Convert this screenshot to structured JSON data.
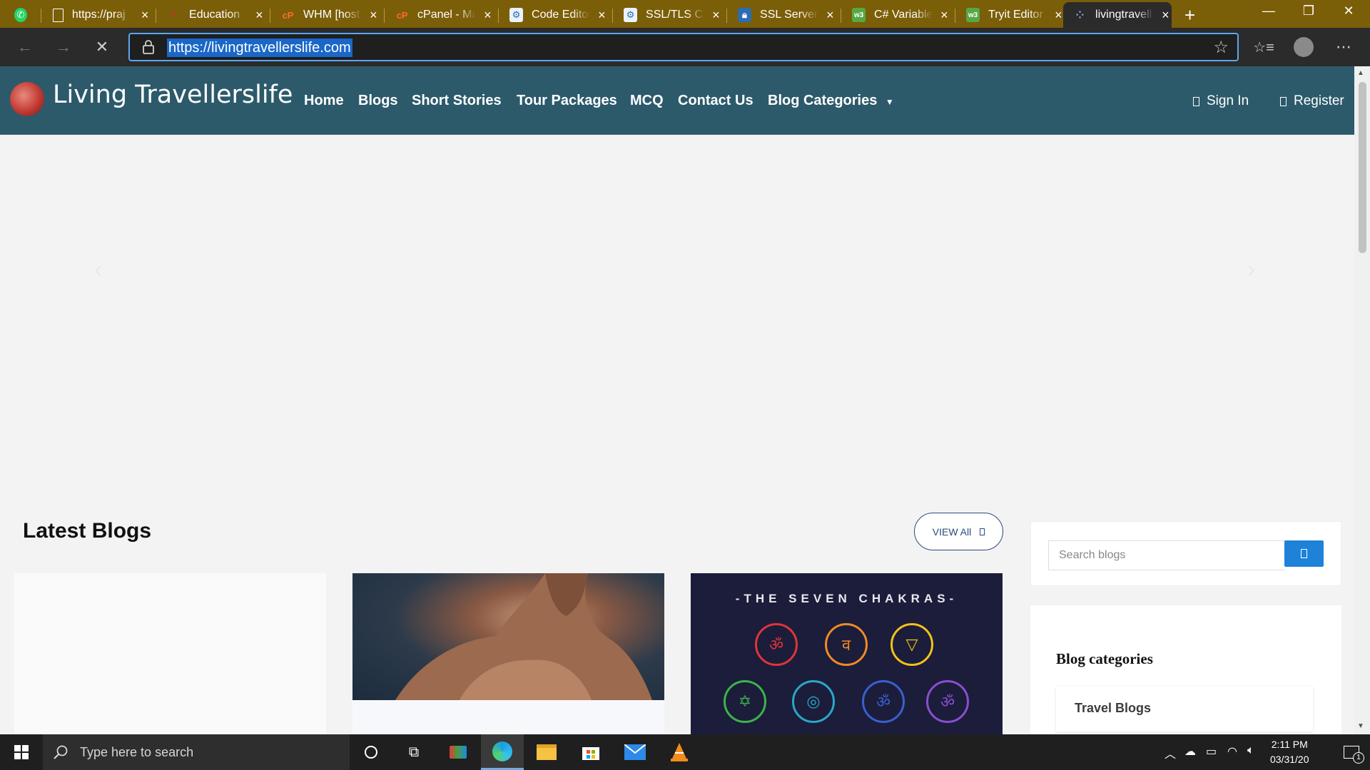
{
  "browser": {
    "tabs": [
      {
        "label": "https://praj",
        "icon": "whatsapp-icon"
      },
      {
        "label": "https://praj",
        "icon": "page-icon"
      },
      {
        "label": "Education",
        "icon": "education-icon"
      },
      {
        "label": "WHM [host",
        "icon": "cpanel-icon"
      },
      {
        "label": "cPanel - Ma",
        "icon": "cpanel-icon"
      },
      {
        "label": "Code Editor",
        "icon": "code-icon"
      },
      {
        "label": "SSL/TLS Cer",
        "icon": "code-icon"
      },
      {
        "label": "SSL Server",
        "icon": "lock-icon"
      },
      {
        "label": "C# Variable",
        "icon": "tryit-icon"
      },
      {
        "label": "Tryit Editor",
        "icon": "tryit-icon"
      },
      {
        "label": "livingtravell",
        "icon": "loading-icon"
      }
    ],
    "new_tab": "+",
    "url": "https://livingtravellerslife.com"
  },
  "site": {
    "brand": "Living Travellerslife",
    "nav": [
      "Home",
      "Blogs",
      "Short Stories",
      "Tour Packages",
      "MCQ",
      "Contact Us",
      "Blog Categories"
    ],
    "sign_in": "Sign In",
    "register": "Register",
    "latest_title": "Latest Blogs",
    "view_all": "VIEW All",
    "search_placeholder": "Search blogs",
    "categories_title": "Blog categories",
    "category_first": "Travel Blogs",
    "chakra_heading": "-THE SEVEN CHAKRAS-"
  },
  "taskbar": {
    "search_placeholder": "Type here to search",
    "time": "2:11 PM",
    "date": "03/31/20",
    "notifications": "1"
  },
  "colors": {
    "tabstrip": "#7b5e08",
    "site_nav": "#2c5a6b",
    "accent_button": "#1e82d8"
  }
}
